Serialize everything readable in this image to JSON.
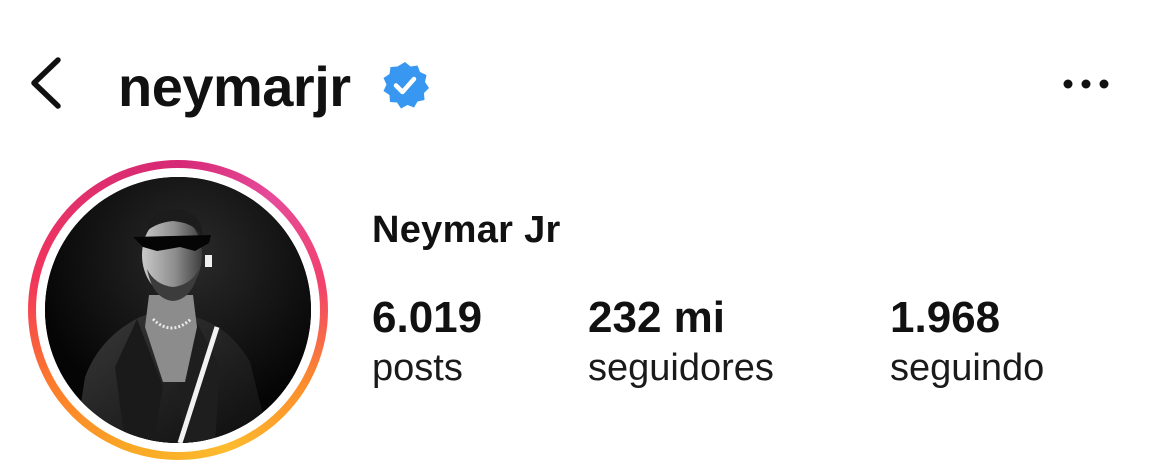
{
  "header": {
    "username": "neymarjr",
    "back_icon": "chevron-left-icon",
    "verified_icon": "verified-badge-icon",
    "more_icon": "more-horizontal-icon",
    "verified_color": "#3897f0"
  },
  "profile": {
    "display_name": "Neymar Jr",
    "avatar_ring_colors": [
      "#fdbb2d",
      "#f3365a",
      "#d62976"
    ],
    "stats": [
      {
        "value": "6.019",
        "label": "posts"
      },
      {
        "value": "232 mi",
        "label": "seguidores"
      },
      {
        "value": "1.968",
        "label": "seguindo"
      }
    ]
  }
}
